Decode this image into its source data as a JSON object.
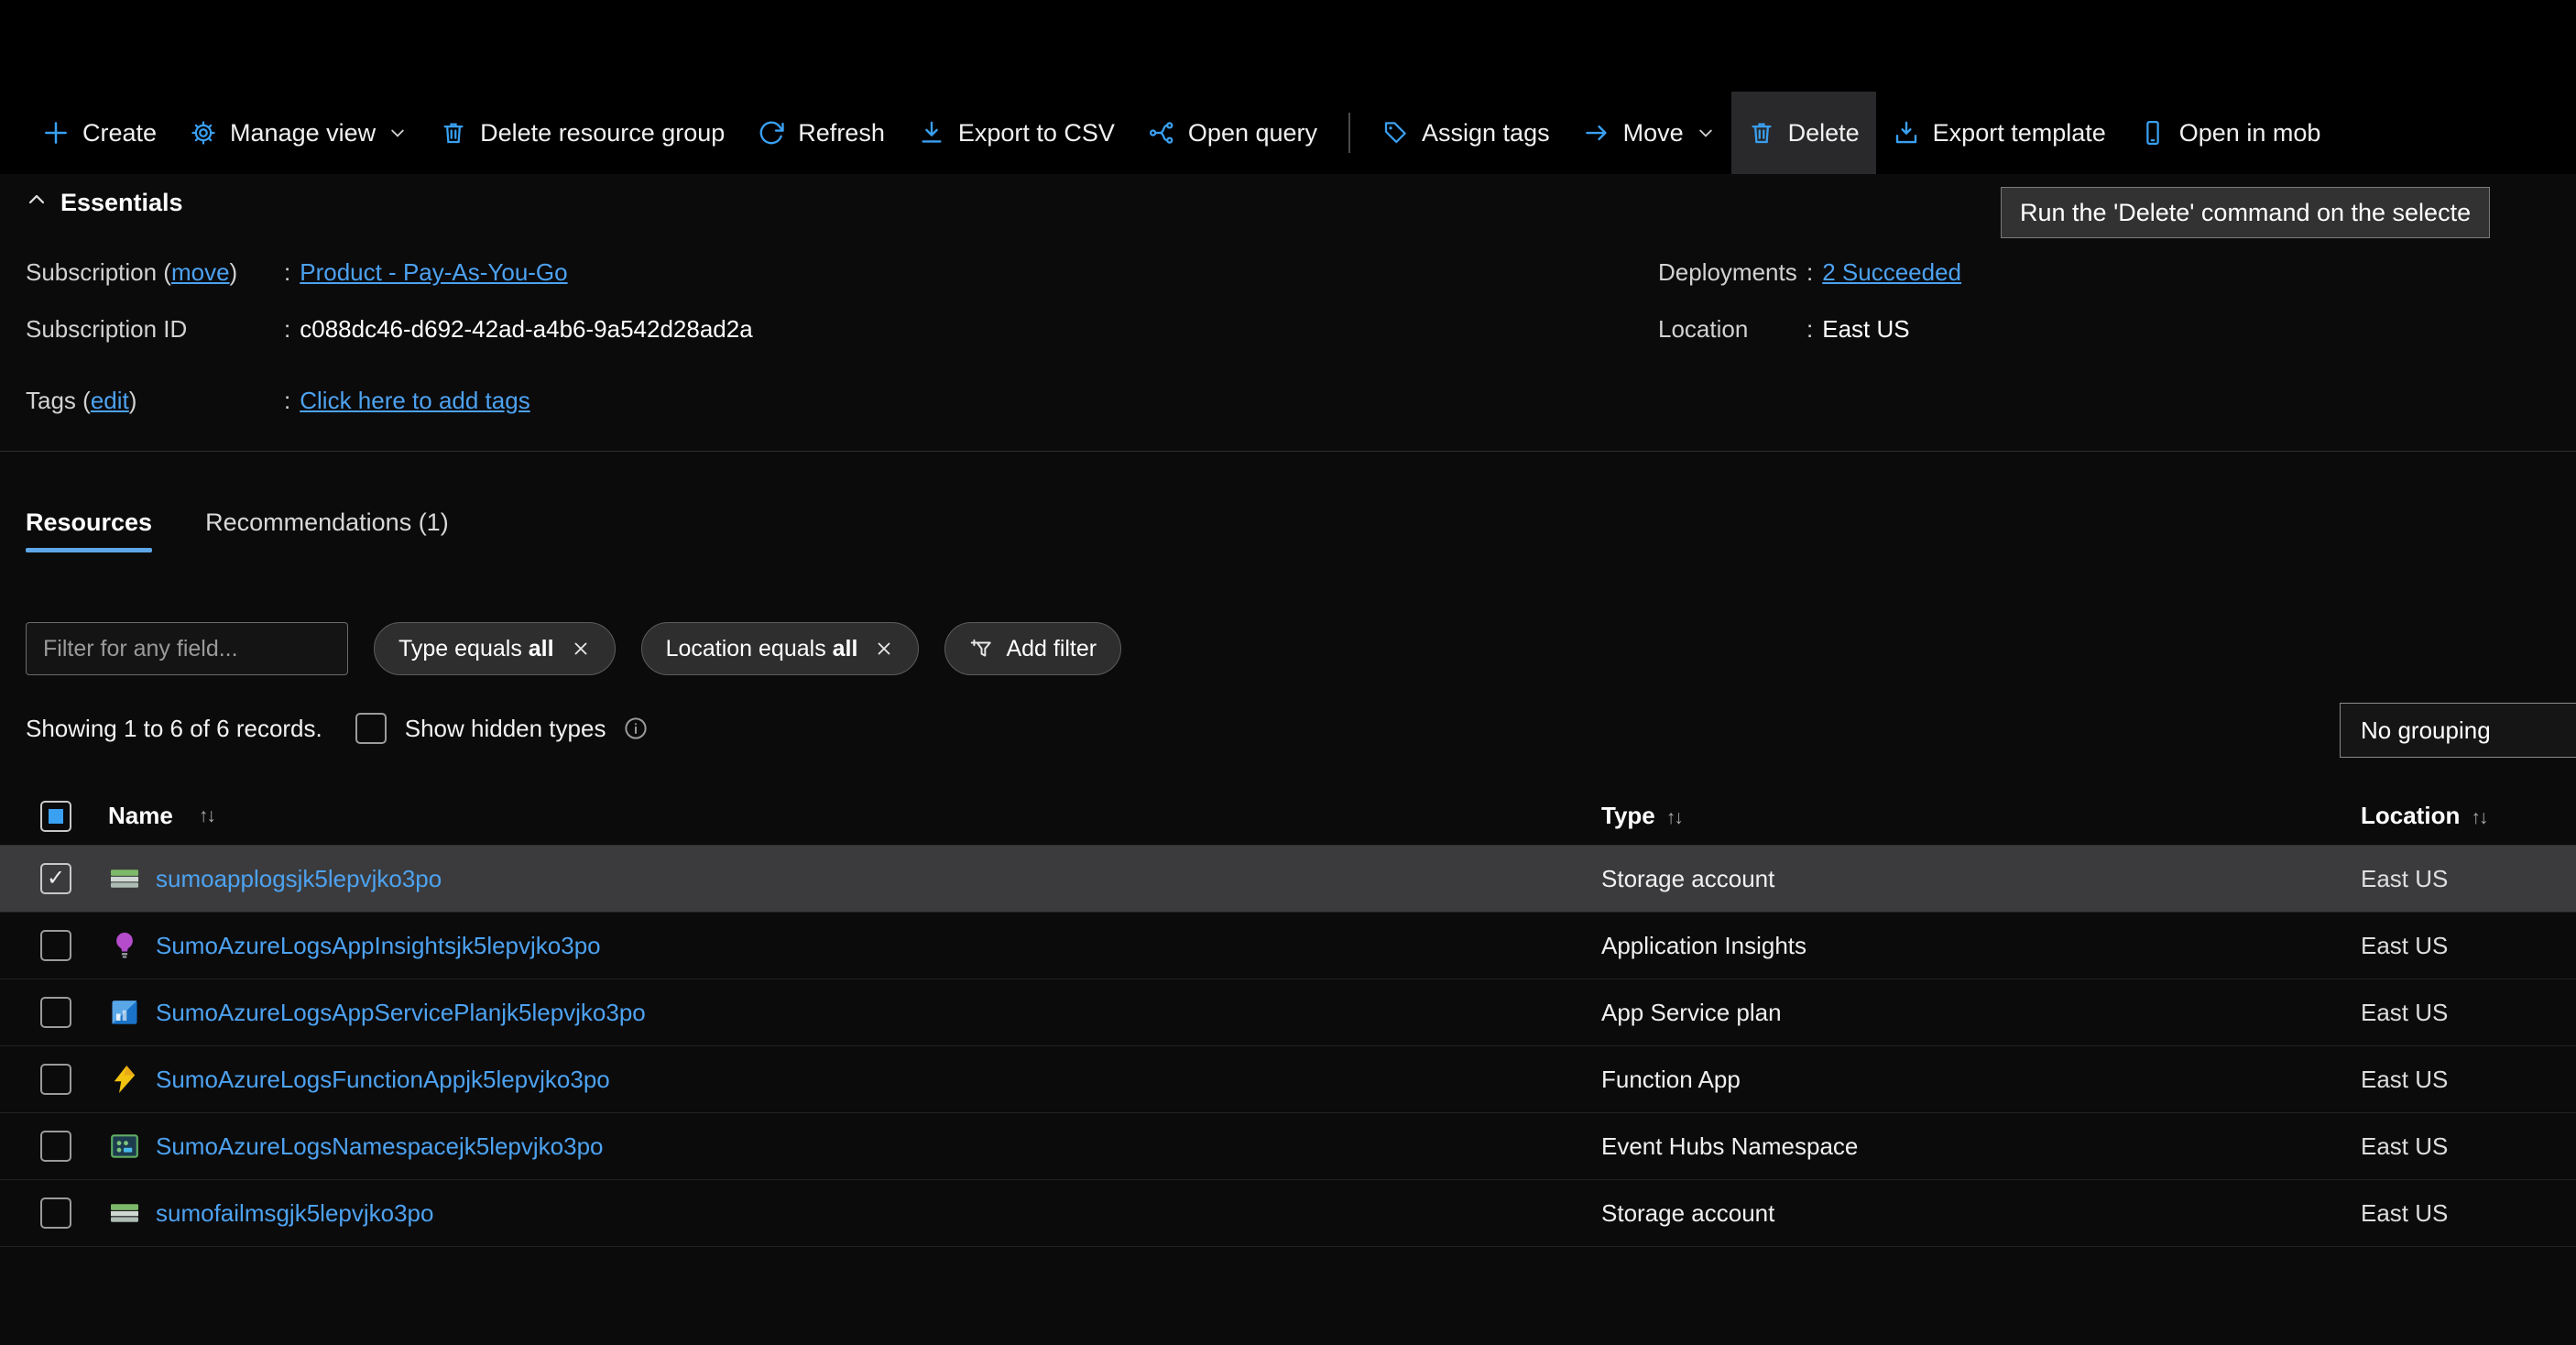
{
  "colors": {
    "accent": "#3aa0f2",
    "link": "#4da2f0",
    "selected_row": "#3b3b3d"
  },
  "icons": {
    "check": "✓",
    "info_glyph": "i",
    "names": [
      "plus-icon",
      "gear-icon",
      "trash-icon",
      "refresh-icon",
      "download-icon",
      "query-icon",
      "tag-icon",
      "arrow-right-icon",
      "export-template-icon",
      "mobile-icon",
      "chevron-down-icon",
      "chevron-up-icon",
      "close-icon",
      "add-filter-icon",
      "info-icon",
      "storage-account-icon",
      "application-insights-icon",
      "app-service-plan-icon",
      "function-app-icon",
      "event-hubs-icon"
    ]
  },
  "toolbar": {
    "items": [
      {
        "label": "Create",
        "icon": "plus-icon"
      },
      {
        "label": "Manage view",
        "icon": "gear-icon",
        "chevron": true
      },
      {
        "label": "Delete resource group",
        "icon": "trash-icon"
      },
      {
        "label": "Refresh",
        "icon": "refresh-icon"
      },
      {
        "label": "Export to CSV",
        "icon": "download-icon"
      },
      {
        "label": "Open query",
        "icon": "query-icon"
      },
      {
        "label": "Assign tags",
        "icon": "tag-icon"
      },
      {
        "label": "Move",
        "icon": "arrow-right-icon",
        "chevron": true
      },
      {
        "label": "Delete",
        "icon": "trash-icon",
        "highlighted": true
      },
      {
        "label": "Export template",
        "icon": "export-template-icon"
      },
      {
        "label": "Open in mob",
        "icon": "mobile-icon",
        "clipped": true
      }
    ]
  },
  "tooltip": {
    "text": "Run the 'Delete' command on the selecte"
  },
  "essentials": {
    "title": "Essentials",
    "colon": ":",
    "subscription": {
      "label_prefix": "Subscription (",
      "link": "move",
      "label_suffix": ")",
      "value": "Product - Pay-As-You-Go"
    },
    "subscription_id": {
      "label": "Subscription ID",
      "value": "c088dc46-d692-42ad-a4b6-9a542d28ad2a"
    },
    "tags": {
      "label_prefix": "Tags (",
      "link": "edit",
      "label_suffix": ")",
      "value": "Click here to add tags"
    },
    "deployments": {
      "label": "Deployments",
      "value": "2 Succeeded"
    },
    "location": {
      "label": "Location",
      "value": "East US"
    }
  },
  "tabs": [
    {
      "label": "Resources",
      "active": true
    },
    {
      "label": "Recommendations (1)",
      "active": false
    }
  ],
  "filters": {
    "search_placeholder": "Filter for any field...",
    "pills": [
      {
        "prefix": "Type equals ",
        "bold": "all"
      },
      {
        "prefix": "Location equals ",
        "bold": "all"
      }
    ],
    "add_filter": "Add filter"
  },
  "records": {
    "summary": "Showing 1 to 6 of 6 records.",
    "show_hidden": "Show hidden types",
    "grouping": "No grouping"
  },
  "table": {
    "sort_glyph": "↑↓",
    "columns": [
      {
        "label": "Name"
      },
      {
        "label": "Type"
      },
      {
        "label": "Location"
      }
    ],
    "rows": [
      {
        "name": "sumoapplogsjk5lepvjko3po",
        "type": "Storage account",
        "location": "East US",
        "icon": "storage-account-icon",
        "selected": true,
        "checked": true
      },
      {
        "name": "SumoAzureLogsAppInsightsjk5lepvjko3po",
        "type": "Application Insights",
        "location": "East US",
        "icon": "application-insights-icon",
        "selected": false,
        "checked": false
      },
      {
        "name": "SumoAzureLogsAppServicePlanjk5lepvjko3po",
        "type": "App Service plan",
        "location": "East US",
        "icon": "app-service-plan-icon",
        "selected": false,
        "checked": false
      },
      {
        "name": "SumoAzureLogsFunctionAppjk5lepvjko3po",
        "type": "Function App",
        "location": "East US",
        "icon": "function-app-icon",
        "selected": false,
        "checked": false
      },
      {
        "name": "SumoAzureLogsNamespacejk5lepvjko3po",
        "type": "Event Hubs Namespace",
        "location": "East US",
        "icon": "event-hubs-icon",
        "selected": false,
        "checked": false
      },
      {
        "name": "sumofailmsgjk5lepvjko3po",
        "type": "Storage account",
        "location": "East US",
        "icon": "storage-account-icon",
        "selected": false,
        "checked": false
      }
    ]
  }
}
